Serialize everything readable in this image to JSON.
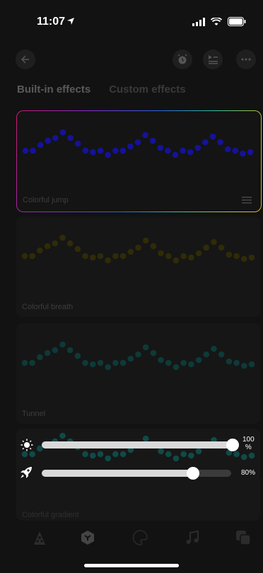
{
  "status": {
    "time": "11:07"
  },
  "tabs": {
    "builtin": "Built-in effects",
    "custom": "Custom effects"
  },
  "effects": [
    {
      "name": "Colorful jump",
      "color": "#15129a",
      "selected": true
    },
    {
      "name": "Colorful breath",
      "color": "#2f2b08"
    },
    {
      "name": "Tunnel",
      "color": "#0d3a38"
    },
    {
      "name": "Colorful gradient",
      "color": "#0f4a48"
    }
  ],
  "controls": {
    "brightness": {
      "value_label": "100\n%",
      "level": 1.0
    },
    "speed": {
      "value_label": "80%",
      "level": 0.8
    }
  },
  "icons": [
    "back-icon",
    "alarm-icon",
    "queue-icon",
    "more-icon",
    "sun-icon",
    "rocket-icon",
    "effects-tab-icon",
    "cube-tab-icon",
    "palette-tab-icon",
    "music-tab-icon",
    "copy-tab-icon"
  ],
  "colors": {
    "background": "#121212",
    "accent_border": "rainbow"
  }
}
